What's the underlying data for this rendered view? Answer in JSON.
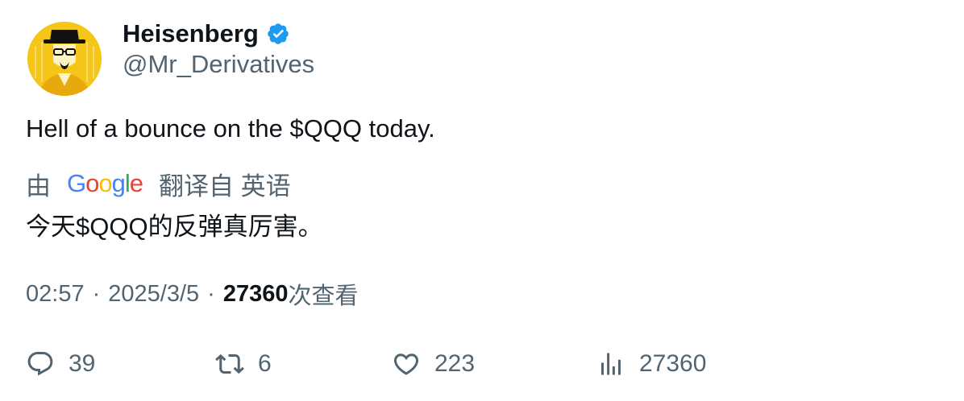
{
  "author": {
    "display_name": "Heisenberg",
    "handle": "@Mr_Derivatives",
    "verified": true
  },
  "tweet": {
    "text": "Hell of a bounce on the $QQQ today."
  },
  "translation": {
    "prefix": "由",
    "provider": "Google",
    "suffix": "翻译自 英语",
    "text": "今天$QQQ的反弹真厉害。"
  },
  "meta": {
    "time": "02:57",
    "separator": "·",
    "date": "2025/3/5",
    "views": "27360",
    "views_label": "次查看"
  },
  "actions": {
    "replies": "39",
    "retweets": "6",
    "likes": "223",
    "views": "27360"
  },
  "colors": {
    "text_primary": "#0f1419",
    "text_secondary": "#536471",
    "verified_blue": "#1d9bf0",
    "avatar_bg": "#f5c518"
  }
}
